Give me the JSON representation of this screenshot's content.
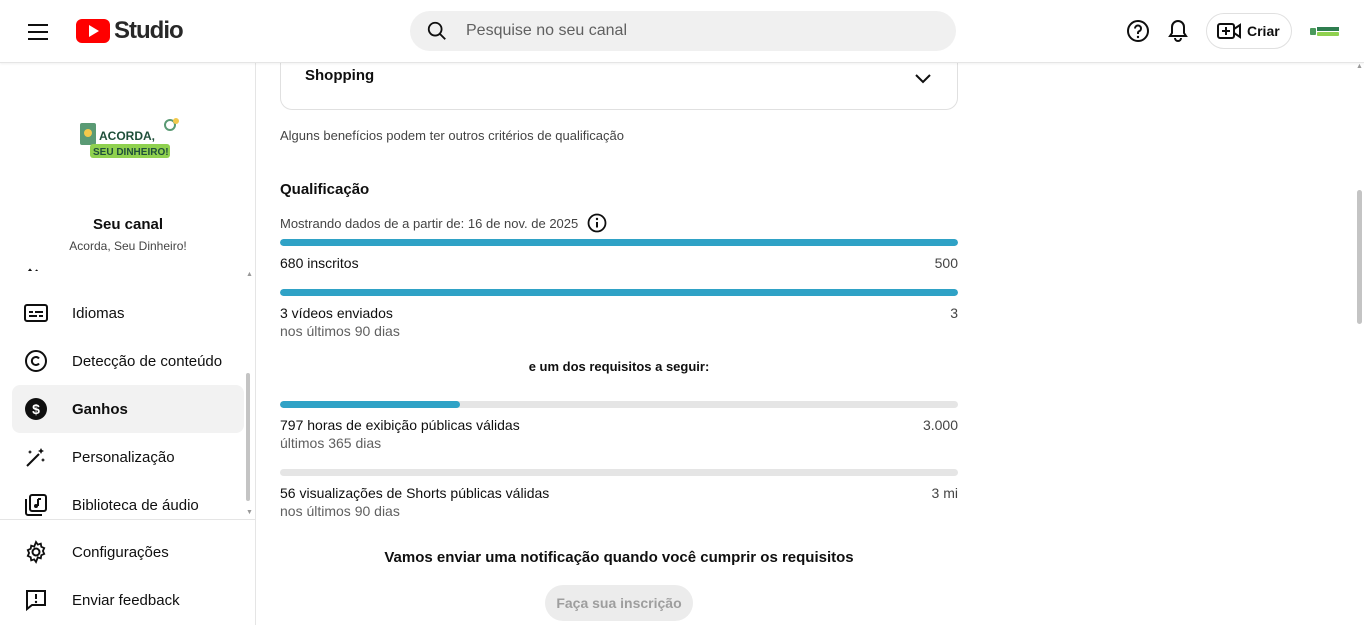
{
  "header": {
    "logo_text": "Studio",
    "search_placeholder": "Pesquise no seu canal",
    "create_label": "Criar"
  },
  "sidebar": {
    "channel_logo_lines": [
      "ACORDA,",
      "SEU DINHEIRO!"
    ],
    "channel_title": "Seu canal",
    "channel_name": "Acorda, Seu Dinheiro!",
    "items": [
      {
        "label": "Idiomas",
        "icon": "subtitles-icon"
      },
      {
        "label": "Detecção de conteúdo",
        "icon": "copyright-icon"
      },
      {
        "label": "Ganhos",
        "icon": "dollar-icon",
        "active": true
      },
      {
        "label": "Personalização",
        "icon": "magic-wand-icon"
      },
      {
        "label": "Biblioteca de áudio",
        "icon": "audio-library-icon"
      }
    ],
    "footer_items": [
      {
        "label": "Configurações",
        "icon": "gear-icon"
      },
      {
        "label": "Enviar feedback",
        "icon": "feedback-icon"
      }
    ]
  },
  "main": {
    "shopping_label": "Shopping",
    "note": "Alguns benefícios podem ter outros critérios de qualificação",
    "qualification_title": "Qualificação",
    "date_text": "Mostrando dados de a partir de: 16 de nov. de 2025",
    "requirements": [
      {
        "label": "680 inscritos",
        "sub": "",
        "target": "500",
        "progress": 1.0
      },
      {
        "label": "3 vídeos enviados",
        "sub": "nos últimos 90 dias",
        "target": "3",
        "progress": 1.0
      },
      {
        "label": "797 horas de exibição públicas válidas",
        "sub": "últimos 365 dias",
        "target": "3.000",
        "progress": 0.266
      },
      {
        "label": "56 visualizações de Shorts públicas válidas",
        "sub": "nos últimos 90 dias",
        "target": "3 mi",
        "progress": 0.0
      }
    ],
    "one_of_note": "e um dos requisitos a seguir:",
    "notify_text": "Vamos enviar uma notificação quando você cumprir os requisitos",
    "subscribe_label": "Faça sua inscrição"
  },
  "colors": {
    "progress": "#2fa2c6",
    "youtube_red": "#ff0000"
  }
}
